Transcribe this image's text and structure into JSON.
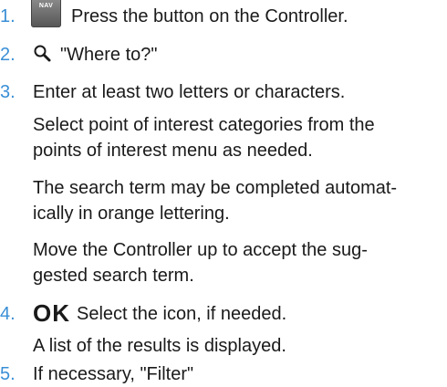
{
  "steps": [
    {
      "number": "1.",
      "icon_label": "NAV",
      "text": "Press the button on the Controller."
    },
    {
      "number": "2.",
      "icon": "search-icon",
      "text": "\"Where to?\""
    },
    {
      "number": "3.",
      "text": "Enter at least two letters or characters.",
      "notes": [
        [
          "Select point of interest categories from the",
          "points of interest menu as needed."
        ],
        [
          "The search term may be completed automat-",
          "ically in orange lettering."
        ],
        [
          "Move the Controller up to accept the sug-",
          "gested search term."
        ]
      ]
    },
    {
      "number": "4.",
      "icon_label": "OK",
      "text": "Select the icon, if needed.",
      "notes": [
        [
          "A list of the results is displayed."
        ]
      ]
    },
    {
      "number": "5.",
      "text": "If necessary, \"Filter\""
    }
  ],
  "colors": {
    "step_number": "#3a8fd6",
    "text": "#1a1a1a",
    "nav_button": "#6f6f6f"
  }
}
